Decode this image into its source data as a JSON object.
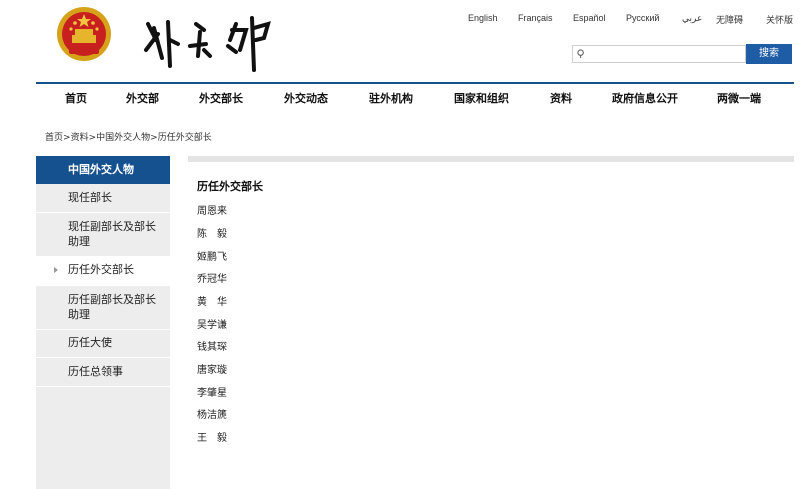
{
  "header": {
    "emblem_icon": "national-emblem-icon",
    "logo_text": "外交部",
    "languages": [
      "English",
      "Français",
      "Español",
      "Русский",
      "عربي",
      "无障碍",
      "关怀版"
    ],
    "search": {
      "placeholder": "",
      "button_label": "搜索"
    }
  },
  "colors": {
    "brand_blue": "#15508f",
    "search_button": "#1f5ca6",
    "sidebar_bg": "#ededed"
  },
  "nav": {
    "items": [
      "首页",
      "外交部",
      "外交部长",
      "外交动态",
      "驻外机构",
      "国家和组织",
      "资料",
      "政府信息公开",
      "两微一端"
    ]
  },
  "breadcrumb": {
    "items": [
      "首页",
      "资料",
      "中国外交人物",
      "历任外交部长"
    ],
    "separator": ">"
  },
  "sidebar": {
    "heading": "中国外交人物",
    "items": [
      "现任部长",
      "现任副部长及部长助理",
      "历任外交部长",
      "历任副部长及部长助理",
      "历任大使",
      "历任总领事"
    ],
    "active_index": 2
  },
  "content": {
    "title": "历任外交部长",
    "ministers": [
      "周恩来",
      "陈　毅",
      "姬鹏飞",
      "乔冠华",
      "黄　华",
      "吴学谦",
      "钱其琛",
      "唐家璇",
      "李肇星",
      "杨洁篪",
      "王　毅"
    ]
  }
}
